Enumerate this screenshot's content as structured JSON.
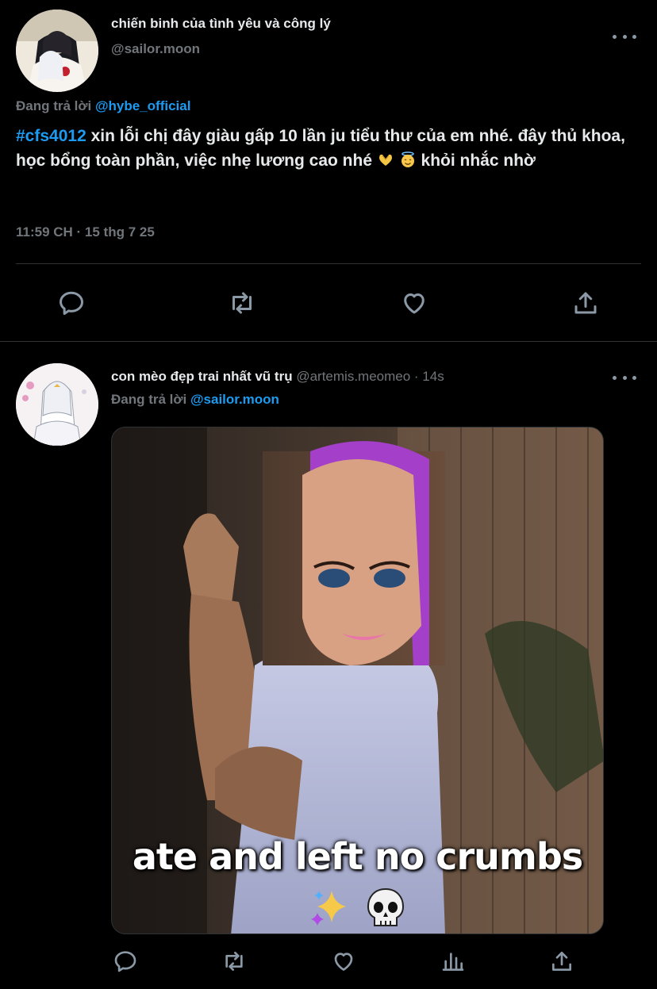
{
  "tweet_main": {
    "author": {
      "display_name": "chiến binh của tình yêu và công lý",
      "handle": "@sailor.moon"
    },
    "reply_prefix": "Đang trả lời",
    "reply_to": "@hybe_official",
    "text": {
      "hashtag": "#cfs4012",
      "body_line1": " xin lỗi chị đây giàu gấp 10 lần ju tiểu thư của em nhé. đây thủ khoa, học bổng toàn phần, việc nhẹ lương cao nhé ",
      "body_end": " khỏi nhắc nhờ",
      "emojis": [
        "heart-hands-emoji",
        "smiling-face-with-halo-emoji"
      ]
    },
    "timestamp": "11:59 CH · 15 thg 7 25",
    "actions": [
      "reply-icon",
      "retweet-icon",
      "like-icon",
      "share-icon"
    ]
  },
  "tweet_reply": {
    "author": {
      "display_name": "con mèo đẹp trai nhất vũ trụ",
      "handle": "@artemis.meomeo",
      "time": "· 14s"
    },
    "reply_prefix": "Đang trả lời",
    "reply_to": "@sailor.moon",
    "media": {
      "caption": "ate and left no crumbs",
      "caption_emojis": [
        "sparkles-emoji",
        "skull-emoji"
      ]
    },
    "actions": [
      "reply-icon",
      "retweet-icon",
      "like-icon",
      "analytics-icon",
      "share-icon"
    ]
  },
  "colors": {
    "background": "#000000",
    "text": "#e7e9ea",
    "secondary": "#71767b",
    "accent": "#1d9bf0",
    "divider": "#2f3336",
    "icon": "#8b98a5"
  }
}
